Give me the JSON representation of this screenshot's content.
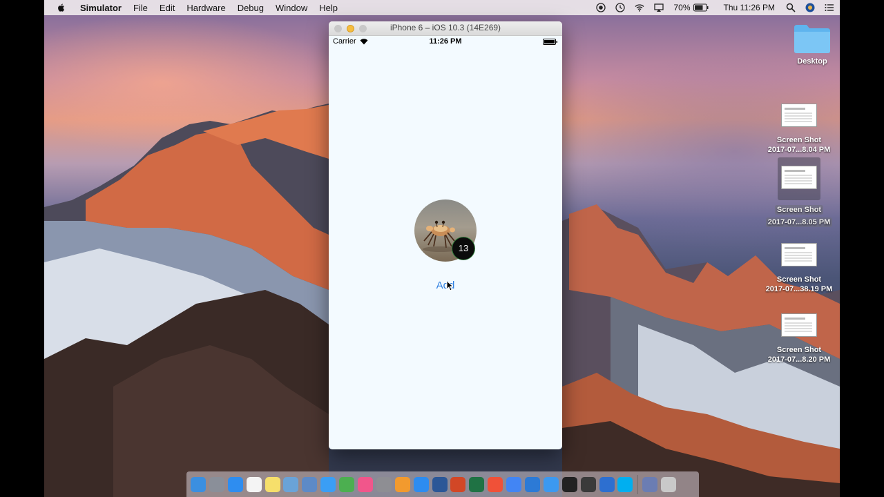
{
  "menubar": {
    "items": [
      "Simulator",
      "File",
      "Edit",
      "Hardware",
      "Debug",
      "Window",
      "Help"
    ],
    "battery_percent": "70%",
    "clock": "Thu 11:26 PM"
  },
  "simulator": {
    "title": "iPhone 6 – iOS 10.3 (14E269)",
    "status_bar": {
      "carrier": "Carrier",
      "time": "11:26 PM"
    },
    "badge_count": "13",
    "add_button_label": "Add"
  },
  "desktop_items": [
    {
      "line1": "Desktop",
      "line2": ""
    },
    {
      "line1": "Screen Shot",
      "line2": "2017-07...8.04 PM"
    },
    {
      "line1": "Screen Shot",
      "line2": "2017-07...8.05 PM"
    },
    {
      "line1": "Screen Shot",
      "line2": "2017-07...38.19 PM"
    },
    {
      "line1": "Screen Shot",
      "line2": "2017-07...8.20 PM"
    }
  ],
  "dock_apps": [
    {
      "icon": "finder-icon",
      "color": "#3b8fe0"
    },
    {
      "icon": "launchpad-icon",
      "color": "#8a8f99"
    },
    {
      "icon": "safari-icon",
      "color": "#2e8df0"
    },
    {
      "icon": "calendar-icon",
      "color": "#f4f4f4"
    },
    {
      "icon": "notes-icon",
      "color": "#f6df6b"
    },
    {
      "icon": "preview-icon",
      "color": "#6aa3d8"
    },
    {
      "icon": "photos-icon",
      "color": "#5d8ac7"
    },
    {
      "icon": "messages-icon",
      "color": "#3a9ef5"
    },
    {
      "icon": "android-studio-icon",
      "color": "#4caf50"
    },
    {
      "icon": "itunes-icon",
      "color": "#f1568b"
    },
    {
      "icon": "system-preferences-icon",
      "color": "#8e8e93"
    },
    {
      "icon": "ibooks-icon",
      "color": "#f29a2e"
    },
    {
      "icon": "app-store-icon",
      "color": "#2d8cf0"
    },
    {
      "icon": "word-icon",
      "color": "#2b5797"
    },
    {
      "icon": "powerpoint-icon",
      "color": "#d24726"
    },
    {
      "icon": "excel-icon",
      "color": "#1f7244"
    },
    {
      "icon": "swift-icon",
      "color": "#f05138"
    },
    {
      "icon": "chrome-icon",
      "color": "#4285f4"
    },
    {
      "icon": "vscode-icon",
      "color": "#2c7ad6"
    },
    {
      "icon": "mail-icon",
      "color": "#3c99f0"
    },
    {
      "icon": "terminal-icon",
      "color": "#222222"
    },
    {
      "icon": "quicktime-icon",
      "color": "#3a3a3a"
    },
    {
      "icon": "xcode-icon",
      "color": "#2d6fd0"
    },
    {
      "icon": "skype-icon",
      "color": "#00aff0"
    },
    {
      "icon": "downloads-stack-icon",
      "color": "#6b7db3"
    },
    {
      "icon": "trash-icon",
      "color": "#c9c9c9"
    }
  ]
}
